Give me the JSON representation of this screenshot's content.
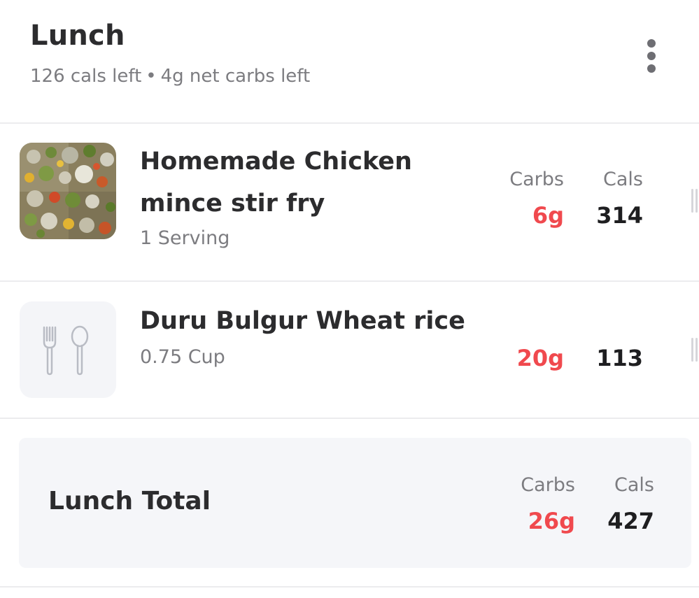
{
  "meal": {
    "title": "Lunch",
    "cals_left": "126 cals left",
    "separator": "•",
    "carbs_left": "4g net carbs left",
    "more_icon": "more-vertical-icon"
  },
  "columns": {
    "carbs_label": "Carbs",
    "cals_label": "Cals"
  },
  "items": [
    {
      "name": "Homemade Chicken mince stir fry",
      "serving": "1 Serving",
      "carbs": "6g",
      "cals": "314",
      "image": "food-photo"
    },
    {
      "name": "Duru Bulgur Wheat rice",
      "serving": "0.75 Cup",
      "carbs": "20g",
      "cals": "113",
      "image": "fork-spoon-icon"
    }
  ],
  "total": {
    "label": "Lunch Total",
    "carbs": "26g",
    "cals": "427"
  },
  "colors": {
    "carbs": "#f0494e",
    "cals": "#1e1e20",
    "muted": "#7c7c80",
    "total_bg": "#f5f6f9"
  }
}
